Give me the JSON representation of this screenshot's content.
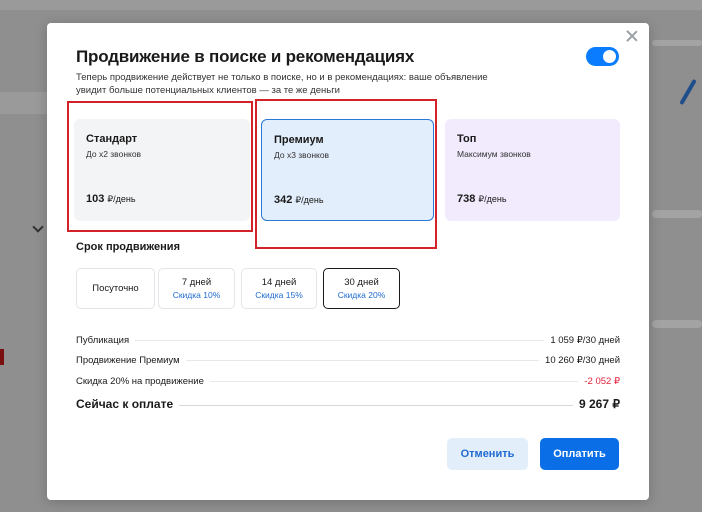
{
  "modal": {
    "title": "Продвижение в поиске и рекомендациях",
    "subtitle": "Теперь продвижение действует не только в поиске, но и в рекомендациях: ваше объявление увидит больше потенциальных клиентов — за те же деньги",
    "toggle_on": true
  },
  "plans": [
    {
      "name": "Стандарт",
      "desc": "До x2 звонков",
      "price": "103",
      "unit": "₽/день"
    },
    {
      "name": "Премиум",
      "desc": "До x3 звонков",
      "price": "342",
      "unit": "₽/день",
      "selected": true
    },
    {
      "name": "Топ",
      "desc": "Максимум звонков",
      "price": "738",
      "unit": "₽/день"
    }
  ],
  "duration": {
    "title": "Срок продвижения",
    "options": [
      {
        "label": "Посуточно",
        "discount": ""
      },
      {
        "label": "7 дней",
        "discount": "Скидка 10%"
      },
      {
        "label": "14 дней",
        "discount": "Скидка 15%"
      },
      {
        "label": "30 дней",
        "discount": "Скидка 20%",
        "selected": true
      }
    ]
  },
  "summary": [
    {
      "label": "Публикация",
      "value": "1 059 ₽/30 дней"
    },
    {
      "label": "Продвижение Премиум",
      "value": "10 260 ₽/30 дней"
    },
    {
      "label": "Скидка 20% на продвижение",
      "value": "-2 052 ₽"
    },
    {
      "label": "Сейчас к оплате",
      "value": "9 267 ₽"
    }
  ],
  "buttons": {
    "cancel": "Отменить",
    "pay": "Оплатить"
  },
  "colors": {
    "accent": "#0a6ee6",
    "premium_border": "#2a78d6",
    "discount": "#e0233a",
    "annotation": "#d2232a"
  }
}
